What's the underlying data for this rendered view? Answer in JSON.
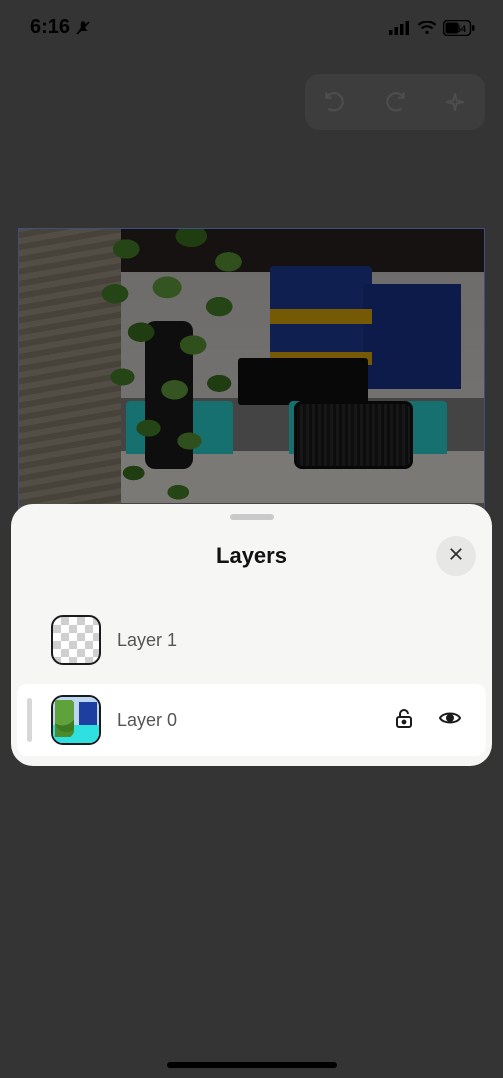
{
  "status": {
    "time": "6:16",
    "battery_text": "54"
  },
  "panel": {
    "title": "Layers"
  },
  "layers": [
    {
      "name": "Layer 1",
      "selected": false
    },
    {
      "name": "Layer 0",
      "selected": true
    }
  ]
}
